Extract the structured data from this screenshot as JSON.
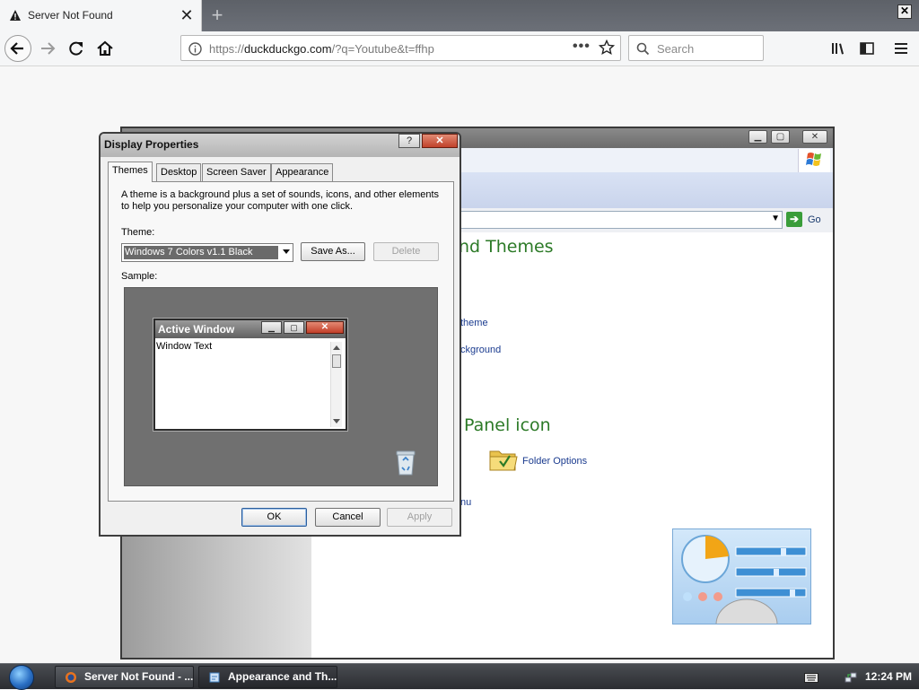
{
  "browser": {
    "tab_title": "Server Not Found",
    "tab_close_glyph": "✕",
    "new_tab_glyph": "+",
    "window_close_glyph": "✕",
    "url_prefix": "https://",
    "url_host": "duckduckgo.com",
    "url_path": "/?q=Youtube&t=ffhp",
    "url_menu_glyph": "•••",
    "search_placeholder": "Search"
  },
  "control_panel": {
    "go_label": "Go",
    "heading_themes": "nd Themes",
    "link_theme": "theme",
    "link_background": "ckground",
    "heading_panel_icon": "Panel icon",
    "link_folder_options": "Folder Options",
    "link_menu": "nu"
  },
  "dialog": {
    "title": "Display Properties",
    "help_glyph": "?",
    "close_glyph": "✕",
    "tabs": [
      {
        "label": "Themes"
      },
      {
        "label": "Desktop"
      },
      {
        "label": "Screen Saver"
      },
      {
        "label": "Appearance"
      }
    ],
    "description": "A theme is a background plus a set of sounds, icons, and other elements to help you personalize your computer with one click.",
    "theme_label": "Theme:",
    "theme_value": "Windows 7 Colors v1.1 Black",
    "save_as_label": "Save As...",
    "delete_label": "Delete",
    "sample_label": "Sample:",
    "ok_label": "OK",
    "cancel_label": "Cancel",
    "apply_label": "Apply"
  },
  "sample_window": {
    "title": "Active Window",
    "body_text": "Window Text",
    "close_glyph": "✕"
  },
  "taskbar": {
    "buttons": [
      {
        "label": "Server Not Found - ..."
      },
      {
        "label": "Appearance and Th..."
      }
    ],
    "clock": "12:24 PM"
  },
  "icons": {
    "tab": "warning-icon",
    "back": "back-arrow-icon",
    "forward": "forward-arrow-icon",
    "reload": "reload-icon",
    "home": "home-icon",
    "site_info": "info-icon",
    "bookmark": "star-icon",
    "search": "search-icon",
    "library": "library-icon",
    "sidebar": "sidebar-icon",
    "menu": "hamburger-menu-icon",
    "folder": "folder-options-icon",
    "recycle": "recycle-bin-icon",
    "start": "windows-start-orb"
  }
}
